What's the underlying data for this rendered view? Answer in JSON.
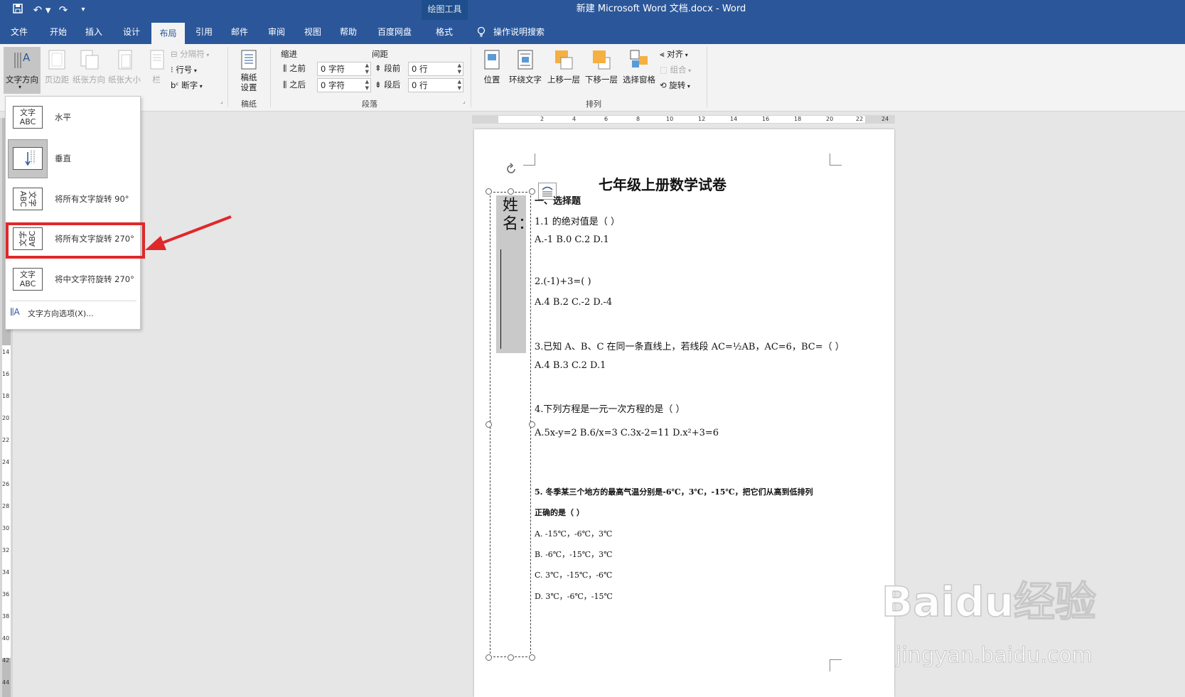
{
  "titlebar": {
    "tool_context": "绘图工具",
    "doc_title": "新建 Microsoft Word 文档.docx  -  Word"
  },
  "tabs": [
    {
      "label": "文件"
    },
    {
      "label": "开始"
    },
    {
      "label": "插入"
    },
    {
      "label": "设计"
    },
    {
      "label": "布局"
    },
    {
      "label": "引用"
    },
    {
      "label": "邮件"
    },
    {
      "label": "审阅"
    },
    {
      "label": "视图"
    },
    {
      "label": "帮助"
    },
    {
      "label": "百度网盘"
    },
    {
      "label": "格式"
    }
  ],
  "tell_me": "操作说明搜索",
  "ribbon": {
    "page_setup": {
      "text_direction": "文字方向",
      "margins": "页边距",
      "orientation": "纸张方向",
      "size": "纸张大小",
      "columns": "栏",
      "breaks": "分隔符",
      "line_numbers": "行号",
      "hyphenation": "断字"
    },
    "manuscript": {
      "button": "稿纸\n设置",
      "group": "稿纸"
    },
    "paragraph": {
      "indent_title": "缩进",
      "spacing_title": "间距",
      "before_label": "之前",
      "after_label": "之后",
      "indent_before": "0 字符",
      "indent_after": "0 字符",
      "spacing_before_label": "段前",
      "spacing_after_label": "段后",
      "spacing_before": "0 行",
      "spacing_after": "0 行",
      "group": "段落"
    },
    "arrange": {
      "position": "位置",
      "wrap_text": "环绕文字",
      "bring_forward": "上移一层",
      "send_backward": "下移一层",
      "selection_pane": "选择窗格",
      "align": "对齐",
      "group_btn": "组合",
      "rotate": "旋转",
      "group": "排列"
    }
  },
  "dropdown": {
    "items": [
      {
        "label": "水平",
        "icon_text": "文字\nABC"
      },
      {
        "label": "垂直",
        "icon_text": ""
      },
      {
        "label": "将所有文字旋转 90°",
        "icon_text": "文字\nABC"
      },
      {
        "label": "将所有文字旋转 270°",
        "icon_text": "文字\nABC"
      },
      {
        "label": "将中文字符旋转 270°",
        "icon_text": "文字\nABC"
      }
    ],
    "options": "文字方向选项(X)..."
  },
  "ruler": {
    "h_ticks": [
      "2",
      "4",
      "6",
      "8",
      "10",
      "12",
      "14",
      "16",
      "18",
      "20",
      "22",
      "24"
    ],
    "v_ticks": [
      "14",
      "16",
      "18",
      "20",
      "22",
      "24",
      "26",
      "28",
      "30",
      "32",
      "34",
      "36",
      "38",
      "40",
      "42",
      "44"
    ]
  },
  "document": {
    "title": "七年级上册数学试卷",
    "textbox_text": "姓名：",
    "section": "一、选择题",
    "lines": [
      "1.1 的绝对值是（   ）",
      "A.-1      B.0      C.2      D.1",
      "2.(-1)+3=(    )",
      "A.4      B.2      C.-2      D.-4",
      "3.已知 A、B、C 在同一条直线上，若线段 AC=½AB，AC=6，BC=（     ）",
      "A.4      B.3      C.2      D.1",
      "4.下列方程是一元一次方程的是（     ）",
      "A.5x-y=2      B.6/x=3      C.3x-2=11      D.x²+3=6",
      "5.  冬季某三个地方的最高气温分别是-6℃，3℃，-15℃，把它们从高到低排列",
      "正确的是（    ）",
      "A.  -15℃，-6℃，3℃",
      "B.  -6℃，-15℃，3℃",
      "C.  3℃，-15℃，-6℃",
      "D.  3℃，-6℃，-15℃"
    ]
  },
  "watermark": {
    "brand": "Baidu经验",
    "url": "jingyan.baidu.com"
  },
  "colors": {
    "accent": "#2b579a",
    "highlight": "#e0282b",
    "selected": "#c5c5c5"
  }
}
